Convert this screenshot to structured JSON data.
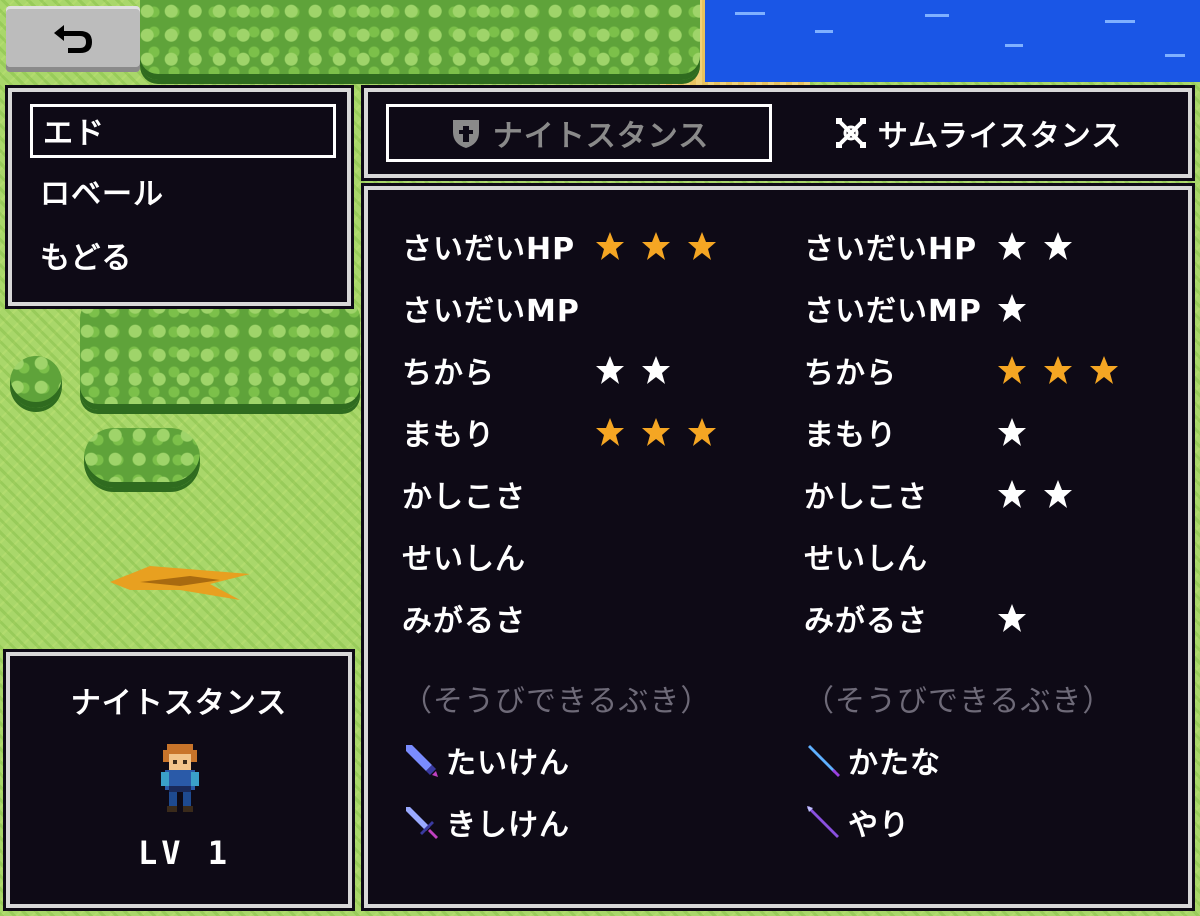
{
  "menu": {
    "items": [
      {
        "label": "エド",
        "selected": true
      },
      {
        "label": "ロベール",
        "selected": false
      },
      {
        "label": "もどる",
        "selected": false
      }
    ]
  },
  "tabs": [
    {
      "label": "ナイトスタンス",
      "icon": "shield-icon",
      "active": true
    },
    {
      "label": "サムライスタンス",
      "icon": "crossed-swords-icon",
      "active": false
    }
  ],
  "colors": {
    "star_gold": "#f5a623",
    "star_white": "#ffffff",
    "panel_bg": "#0e0a16",
    "border": "#d8d8d8",
    "muted_text": "#6e6a78"
  },
  "stances": [
    {
      "name": "ナイトスタンス",
      "stats": [
        {
          "label": "さいだいHP",
          "stars": 3,
          "color": "gold"
        },
        {
          "label": "さいだいMP",
          "stars": 0,
          "color": "white"
        },
        {
          "label": "ちから",
          "stars": 2,
          "color": "white"
        },
        {
          "label": "まもり",
          "stars": 3,
          "color": "gold"
        },
        {
          "label": "かしこさ",
          "stars": 0,
          "color": "white"
        },
        {
          "label": "せいしん",
          "stars": 0,
          "color": "white"
        },
        {
          "label": "みがるさ",
          "stars": 0,
          "color": "white"
        }
      ],
      "weapons_label": "（そうびできるぶき）",
      "weapons": [
        {
          "label": "たいけん",
          "icon": "greatsword-icon"
        },
        {
          "label": "きしけん",
          "icon": "knight-sword-icon"
        }
      ]
    },
    {
      "name": "サムライスタンス",
      "stats": [
        {
          "label": "さいだいHP",
          "stars": 2,
          "color": "white"
        },
        {
          "label": "さいだいMP",
          "stars": 1,
          "color": "white"
        },
        {
          "label": "ちから",
          "stars": 3,
          "color": "gold"
        },
        {
          "label": "まもり",
          "stars": 1,
          "color": "white"
        },
        {
          "label": "かしこさ",
          "stars": 2,
          "color": "white"
        },
        {
          "label": "せいしん",
          "stars": 0,
          "color": "white"
        },
        {
          "label": "みがるさ",
          "stars": 1,
          "color": "white"
        }
      ],
      "weapons_label": "（そうびできるぶき）",
      "weapons": [
        {
          "label": "かたな",
          "icon": "katana-icon"
        },
        {
          "label": "やり",
          "icon": "spear-icon"
        }
      ]
    }
  ],
  "character": {
    "stance": "ナイトスタンス",
    "level_text": "LV 1",
    "sprite": "knight-character-sprite"
  }
}
